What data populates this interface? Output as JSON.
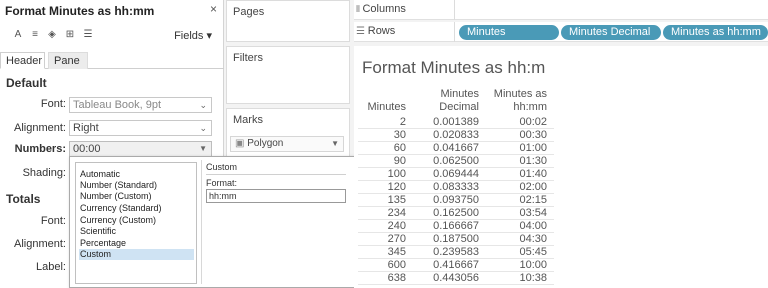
{
  "format_pane": {
    "title": "Format Minutes as hh:mm",
    "close_glyph": "×",
    "fields_label": "Fields ▾",
    "tabs": [
      "Header",
      "Pane"
    ],
    "default_heading": "Default",
    "font_label": "Font:",
    "font_value": "Tableau Book, 9pt",
    "alignment_label": "Alignment:",
    "alignment_value": "Right",
    "numbers_label": "Numbers:",
    "numbers_value": "00:00",
    "shading_label": "Shading:",
    "totals_heading": "Totals",
    "totals_font_label": "Font:",
    "totals_alignment_label": "Alignment:",
    "totals_label_label": "Label:"
  },
  "number_format_popup": {
    "options": [
      "Automatic",
      "Number (Standard)",
      "Number (Custom)",
      "Currency (Standard)",
      "Currency (Custom)",
      "Scientific",
      "Percentage",
      "Custom"
    ],
    "selected": "Custom",
    "custom_title": "Custom",
    "format_label": "Format:",
    "format_value": "hh:mm"
  },
  "shelves": {
    "pages": "Pages",
    "filters": "Filters",
    "marks": "Marks",
    "mark_type": "Polygon",
    "columns_label": "Columns",
    "rows_label": "Rows",
    "row_pills": [
      "Minutes",
      "Minutes Decimal",
      "Minutes as hh:mm"
    ]
  },
  "viz": {
    "title": "Format Minutes as hh:m",
    "headers": [
      "Minutes",
      "Minutes Decimal",
      "Minutes as hh:mm"
    ],
    "rows": [
      [
        "2",
        "0.001389",
        "00:02"
      ],
      [
        "30",
        "0.020833",
        "00:30"
      ],
      [
        "60",
        "0.041667",
        "01:00"
      ],
      [
        "90",
        "0.062500",
        "01:30"
      ],
      [
        "100",
        "0.069444",
        "01:40"
      ],
      [
        "120",
        "0.083333",
        "02:00"
      ],
      [
        "135",
        "0.093750",
        "02:15"
      ],
      [
        "234",
        "0.162500",
        "03:54"
      ],
      [
        "240",
        "0.166667",
        "04:00"
      ],
      [
        "270",
        "0.187500",
        "04:30"
      ],
      [
        "345",
        "0.239583",
        "05:45"
      ],
      [
        "600",
        "0.416667",
        "10:00"
      ],
      [
        "638",
        "0.443056",
        "10:38"
      ]
    ]
  },
  "colors": {
    "pill": "#4a9ab7",
    "selection": "#cfe3f3"
  }
}
